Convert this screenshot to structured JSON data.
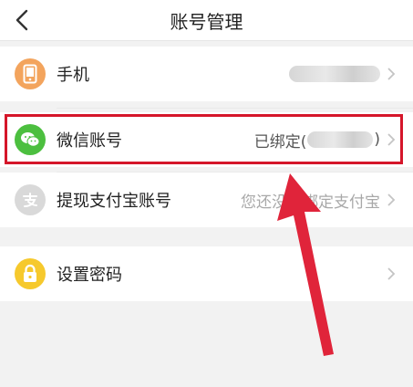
{
  "header": {
    "title": "账号管理"
  },
  "rows": [
    {
      "label": "手机",
      "value": "",
      "icon": "phone-icon",
      "icon_color": "#f3a45d"
    },
    {
      "label": "微信账号",
      "value": "已绑定(",
      "value_end": ")",
      "icon": "wechat-icon",
      "icon_color": "#4cbf3f"
    },
    {
      "label": "提现支付宝账号",
      "value": "您还没有绑定支付宝",
      "icon": "alipay-icon",
      "icon_color": "#d9d9d9"
    },
    {
      "label": "设置密码",
      "value": "",
      "icon": "lock-icon",
      "icon_color": "#f6c92d"
    }
  ],
  "colors": {
    "highlight": "#d5162a",
    "arrow": "#e0243a"
  }
}
